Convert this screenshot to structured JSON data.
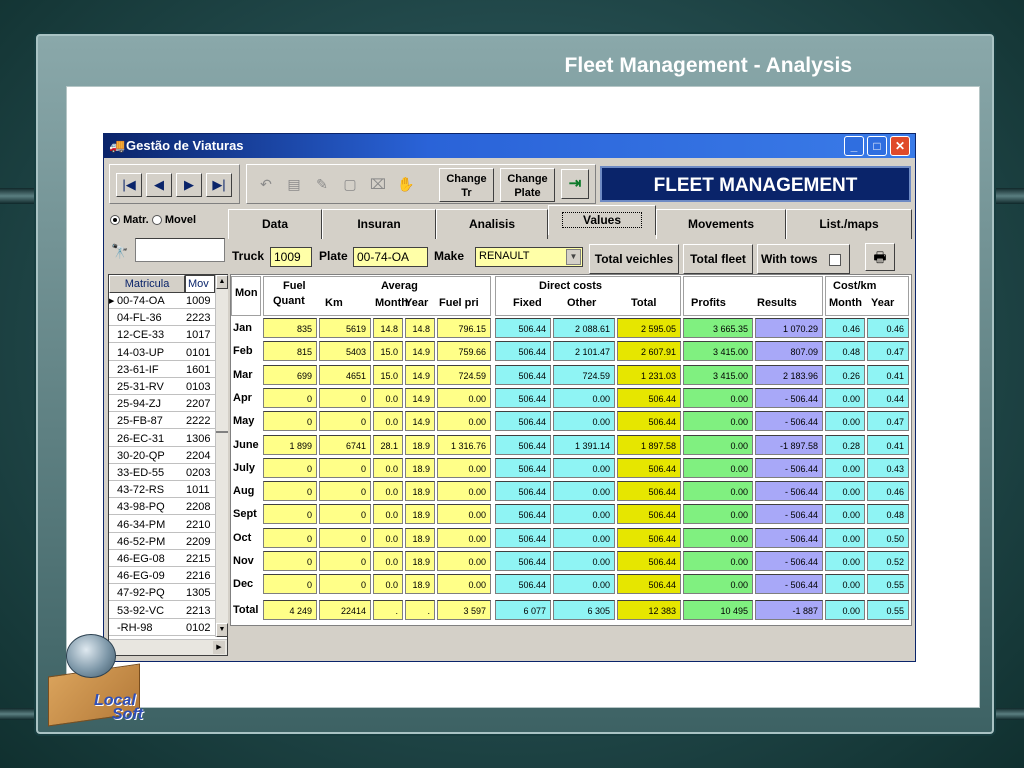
{
  "slide": {
    "title": "Fleet Management - Analysis",
    "logo_line1": "Local",
    "logo_line2": "Soft"
  },
  "window": {
    "title": "Gestão de Viaturas",
    "banner": "FLEET MANAGEMENT"
  },
  "toolbar": {
    "change_tr_l1": "Change",
    "change_tr_l2": "Tr",
    "change_plate_l1": "Change",
    "change_plate_l2": "Plate"
  },
  "left_panel": {
    "radio_matr": "Matr.",
    "radio_movel": "Movel",
    "radio_selected": "matr",
    "col_matricula": "Matricula",
    "col_mov": "Mov"
  },
  "list_rows": [
    {
      "plate": "00-74-OA",
      "code": "1009"
    },
    {
      "plate": "04-FL-36",
      "code": "2223"
    },
    {
      "plate": "12-CE-33",
      "code": "1017"
    },
    {
      "plate": "14-03-UP",
      "code": "0101"
    },
    {
      "plate": "23-61-IF",
      "code": "1601"
    },
    {
      "plate": "25-31-RV",
      "code": "0103"
    },
    {
      "plate": "25-94-ZJ",
      "code": "2207"
    },
    {
      "plate": "25-FB-87",
      "code": "2222"
    },
    {
      "plate": "26-EC-31",
      "code": "1306"
    },
    {
      "plate": "30-20-QP",
      "code": "2204"
    },
    {
      "plate": "33-ED-55",
      "code": "0203"
    },
    {
      "plate": "43-72-RS",
      "code": "1011"
    },
    {
      "plate": "43-98-PQ",
      "code": "2208"
    },
    {
      "plate": "46-34-PM",
      "code": "2210"
    },
    {
      "plate": "46-52-PM",
      "code": "2209"
    },
    {
      "plate": "46-EG-08",
      "code": "2215"
    },
    {
      "plate": "46-EG-09",
      "code": "2216"
    },
    {
      "plate": "47-92-PQ",
      "code": "1305"
    },
    {
      "plate": "53-92-VC",
      "code": "2213"
    },
    {
      "plate": "-RH-98",
      "code": "0102"
    }
  ],
  "tabs": [
    "Data",
    "Insuran",
    "Analisis",
    "Values",
    "Movements",
    "List./maps"
  ],
  "active_tab": "Values",
  "truck_bar": {
    "truck_label": "Truck",
    "truck_value": "1009",
    "plate_label": "Plate",
    "plate_value": "00-74-OA",
    "make_label": "Make",
    "make_value": "RENAULT",
    "total_vehicles": "Total veichles",
    "total_fleet": "Total fleet",
    "with_tows": "With tows"
  },
  "grid_headers": {
    "month": "Mon",
    "fuel_l1": "Fuel",
    "fuel_l2": "Quant",
    "km": "Km",
    "average": "Averag",
    "month_avg": "Month",
    "year_avg": "Year",
    "fuel_price": "Fuel pri",
    "direct_costs": "Direct costs",
    "fixed": "Fixed",
    "other": "Other",
    "total": "Total",
    "profits": "Profits",
    "results": "Results",
    "cost_km": "Cost/km",
    "ck_month": "Month",
    "ck_year": "Year"
  },
  "rows": [
    {
      "m": "Jan",
      "fq": "835",
      "km": "5619",
      "am": "14.8",
      "ay": "14.8",
      "fp": "796.15",
      "fx": "506.44",
      "ot": "2 088.61",
      "tt": "2 595.05",
      "pr": "3 665.35",
      "rs": "1 070.29",
      "cm": "0.46",
      "cy": "0.46"
    },
    {
      "m": "Feb",
      "fq": "815",
      "km": "5403",
      "am": "15.0",
      "ay": "14.9",
      "fp": "759.66",
      "fx": "506.44",
      "ot": "2 101.47",
      "tt": "2 607.91",
      "pr": "3 415.00",
      "rs": "807.09",
      "cm": "0.48",
      "cy": "0.47"
    },
    {
      "m": "Mar",
      "fq": "699",
      "km": "4651",
      "am": "15.0",
      "ay": "14.9",
      "fp": "724.59",
      "fx": "506.44",
      "ot": "724.59",
      "tt": "1 231.03",
      "pr": "3 415.00",
      "rs": "2 183.96",
      "cm": "0.26",
      "cy": "0.41"
    },
    {
      "m": "Apr",
      "fq": "0",
      "km": "0",
      "am": "0.0",
      "ay": "14.9",
      "fp": "0.00",
      "fx": "506.44",
      "ot": "0.00",
      "tt": "506.44",
      "pr": "0.00",
      "rs": "- 506.44",
      "cm": "0.00",
      "cy": "0.44"
    },
    {
      "m": "May",
      "fq": "0",
      "km": "0",
      "am": "0.0",
      "ay": "14.9",
      "fp": "0.00",
      "fx": "506.44",
      "ot": "0.00",
      "tt": "506.44",
      "pr": "0.00",
      "rs": "- 506.44",
      "cm": "0.00",
      "cy": "0.47"
    },
    {
      "m": "June",
      "fq": "1 899",
      "km": "6741",
      "am": "28.1",
      "ay": "18.9",
      "fp": "1 316.76",
      "fx": "506.44",
      "ot": "1 391.14",
      "tt": "1 897.58",
      "pr": "0.00",
      "rs": "-1 897.58",
      "cm": "0.28",
      "cy": "0.41"
    },
    {
      "m": "July",
      "fq": "0",
      "km": "0",
      "am": "0.0",
      "ay": "18.9",
      "fp": "0.00",
      "fx": "506.44",
      "ot": "0.00",
      "tt": "506.44",
      "pr": "0.00",
      "rs": "- 506.44",
      "cm": "0.00",
      "cy": "0.43"
    },
    {
      "m": "Aug",
      "fq": "0",
      "km": "0",
      "am": "0.0",
      "ay": "18.9",
      "fp": "0.00",
      "fx": "506.44",
      "ot": "0.00",
      "tt": "506.44",
      "pr": "0.00",
      "rs": "- 506.44",
      "cm": "0.00",
      "cy": "0.46"
    },
    {
      "m": "Sept",
      "fq": "0",
      "km": "0",
      "am": "0.0",
      "ay": "18.9",
      "fp": "0.00",
      "fx": "506.44",
      "ot": "0.00",
      "tt": "506.44",
      "pr": "0.00",
      "rs": "- 506.44",
      "cm": "0.00",
      "cy": "0.48"
    },
    {
      "m": "Oct",
      "fq": "0",
      "km": "0",
      "am": "0.0",
      "ay": "18.9",
      "fp": "0.00",
      "fx": "506.44",
      "ot": "0.00",
      "tt": "506.44",
      "pr": "0.00",
      "rs": "- 506.44",
      "cm": "0.00",
      "cy": "0.50"
    },
    {
      "m": "Nov",
      "fq": "0",
      "km": "0",
      "am": "0.0",
      "ay": "18.9",
      "fp": "0.00",
      "fx": "506.44",
      "ot": "0.00",
      "tt": "506.44",
      "pr": "0.00",
      "rs": "- 506.44",
      "cm": "0.00",
      "cy": "0.52"
    },
    {
      "m": "Dec",
      "fq": "0",
      "km": "0",
      "am": "0.0",
      "ay": "18.9",
      "fp": "0.00",
      "fx": "506.44",
      "ot": "0.00",
      "tt": "506.44",
      "pr": "0.00",
      "rs": "- 506.44",
      "cm": "0.00",
      "cy": "0.55"
    }
  ],
  "total_row": {
    "m": "Total",
    "fq": "4 249",
    "km": "22414",
    "am": ".",
    "ay": ".",
    "fp": "3 597",
    "fx": "6 077",
    "ot": "6 305",
    "tt": "12 383",
    "pr": "10 495",
    "rs": "-1 887",
    "cm": "0.00",
    "cy": "0.55"
  },
  "colors": {
    "fuel": "#ffff88",
    "costs": "#8ff4f4",
    "profits": "#80f080",
    "results": "#a8a8f8",
    "total": "#e6e600",
    "banner": "#0a246a"
  }
}
